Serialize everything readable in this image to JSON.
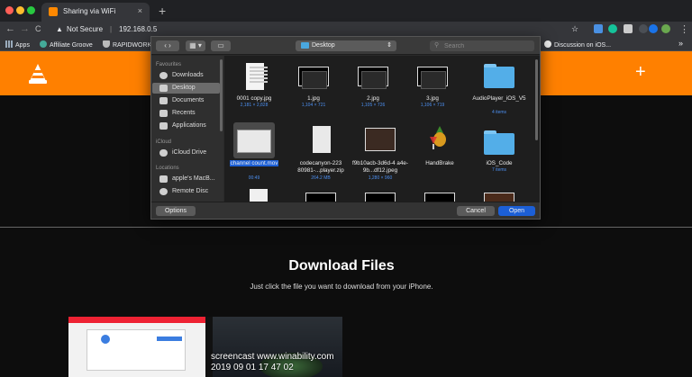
{
  "browser": {
    "tab": {
      "title": "Sharing via WiFi",
      "close": "×"
    },
    "new_tab": "+",
    "nav": {
      "back": "←",
      "forward": "→",
      "reload": "C"
    },
    "omnibox": {
      "security": "Not Secure",
      "separator": "|",
      "url": "192.168.0.5"
    },
    "bookmarks": {
      "apps": "Apps",
      "items": [
        "Affiliate Groove",
        "RAPIDWORK"
      ],
      "right_item": "Discussion on iOS...",
      "overflow": "»"
    },
    "colors": {
      "frame": "#202124",
      "toolbar": "#35363a"
    }
  },
  "page": {
    "brand_color": "#ff8000",
    "plus_label": "+",
    "download": {
      "title": "Download Files",
      "subtitle": "Just click the file you want to download from your iPhone."
    },
    "watermark": {
      "line1": "screencast www.winability.com",
      "line2": "2019 09 01 17 47 02"
    }
  },
  "dialog": {
    "location": "Desktop",
    "search_placeholder": "Search",
    "sidebar": {
      "favourites_heading": "Favourites",
      "favourites": [
        "Downloads",
        "Desktop",
        "Documents",
        "Recents",
        "Applications"
      ],
      "selected": "Desktop",
      "icloud_heading": "iCloud",
      "icloud": [
        "iCloud Drive"
      ],
      "locations_heading": "Locations",
      "locations": [
        "apple's MacB...",
        "Remote Disc"
      ]
    },
    "files": [
      {
        "name": "0001 copy.jpg",
        "meta": "2,181 × 2,828",
        "kind": "doc"
      },
      {
        "name": "1.jpg",
        "meta": "1,104 × 721",
        "kind": "image"
      },
      {
        "name": "2.jpg",
        "meta": "1,105 × 726",
        "kind": "image"
      },
      {
        "name": "3.jpg",
        "meta": "1,106 × 719",
        "kind": "image"
      },
      {
        "name": "AudioPlayer_iOS_V5",
        "meta": "4 items",
        "kind": "folder"
      },
      {
        "name": "channel count.mov",
        "meta": "00:49",
        "kind": "video",
        "selected": true
      },
      {
        "name": "codecanyon-223 80981-...player.zip",
        "meta": "264.2 MB",
        "kind": "zip"
      },
      {
        "name": "f9b10acb-3d6d-4 a4e-9b...df12.jpeg",
        "meta": "1,280 × 960",
        "kind": "photo"
      },
      {
        "name": "HandBrake",
        "meta": "",
        "kind": "app"
      },
      {
        "name": "iOS_Code",
        "meta": "7 items",
        "kind": "folder"
      }
    ],
    "buttons": {
      "options": "Options",
      "cancel": "Cancel",
      "open": "Open"
    },
    "colors": {
      "accent": "#1c5fd6",
      "folder": "#53aee8"
    }
  }
}
